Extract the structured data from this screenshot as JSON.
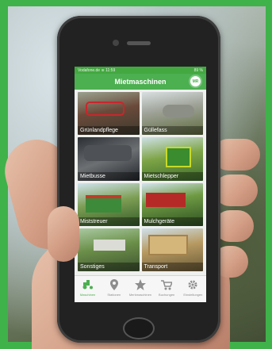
{
  "status": {
    "carrier": "Vodafone.de",
    "time": "11:59",
    "battery": "89 %"
  },
  "header": {
    "title": "Mietmaschinen",
    "logo": "MR"
  },
  "tiles": [
    {
      "label": "Grünlandpflege"
    },
    {
      "label": "Güllefass"
    },
    {
      "label": "Mietbusse"
    },
    {
      "label": "Mietschlepper"
    },
    {
      "label": "Miststreuer"
    },
    {
      "label": "Mulchgeräte"
    },
    {
      "label": "Sonstiges"
    },
    {
      "label": "Transport"
    }
  ],
  "tabs": [
    {
      "label": "Maschinen",
      "icon": "tractor-icon"
    },
    {
      "label": "Stationen",
      "icon": "location-pin-icon"
    },
    {
      "label": "Merkmaschinen",
      "icon": "star-icon"
    },
    {
      "label": "Buchungen",
      "icon": "cart-icon"
    },
    {
      "label": "Einstellungen",
      "icon": "gear-icon"
    }
  ],
  "colors": {
    "frame": "#3fb24a",
    "accent": "#4caf50"
  }
}
